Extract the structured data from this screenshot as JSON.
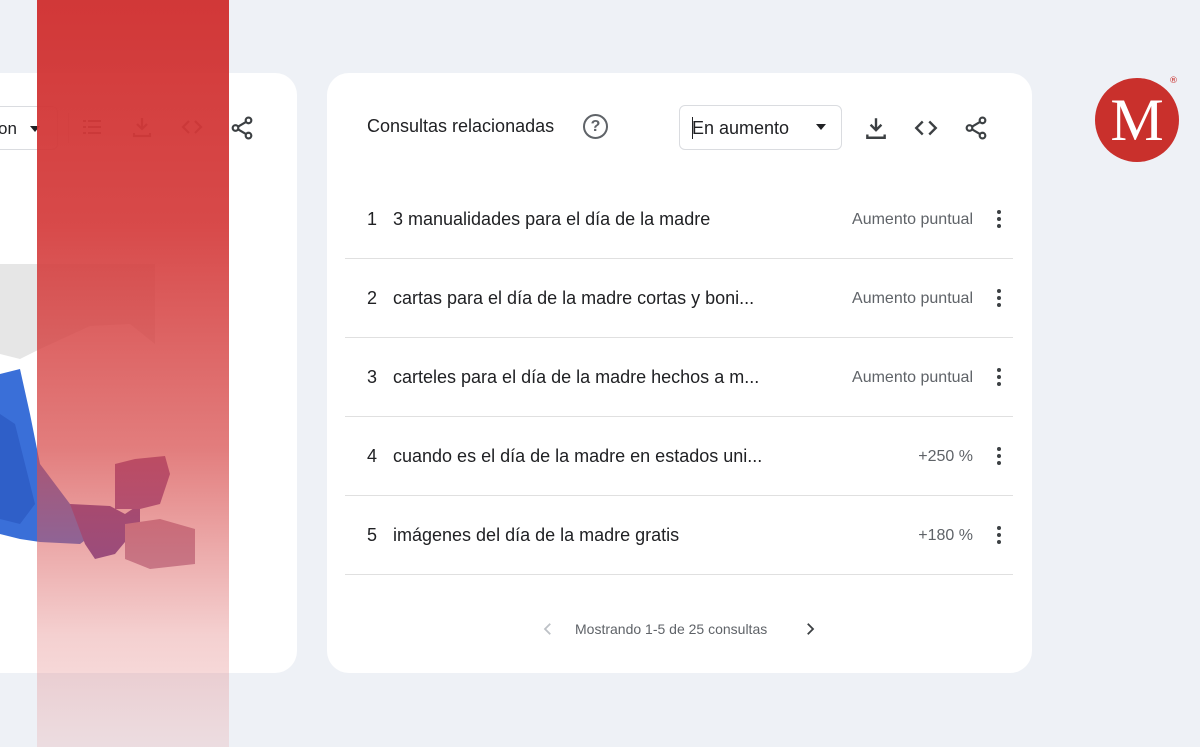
{
  "left_panel": {
    "select_value": "on",
    "icons": [
      "list-icon",
      "download-icon",
      "embed-icon",
      "share-icon"
    ]
  },
  "related_queries": {
    "title": "Consultas relacionadas",
    "help_icon": "help-icon",
    "filter": {
      "selected": "En aumento"
    },
    "toolbar": [
      "download-icon",
      "embed-icon",
      "share-icon"
    ],
    "rows": [
      {
        "rank": "1",
        "query": "3 manualidades para el día de la madre",
        "value": "Aumento puntual"
      },
      {
        "rank": "2",
        "query": "cartas para el día de la madre cortas y boni...",
        "value": "Aumento puntual"
      },
      {
        "rank": "3",
        "query": "carteles para el día de la madre hechos a m...",
        "value": "Aumento puntual"
      },
      {
        "rank": "4",
        "query": "cuando es el día de la madre en estados uni...",
        "value": "+250 %"
      },
      {
        "rank": "5",
        "query": "imágenes del día de la madre gratis",
        "value": "+180 %"
      }
    ],
    "pagination": {
      "text": "Mostrando 1-5 de 25 consultas"
    }
  },
  "logo": {
    "letter": "M",
    "mark": "®"
  },
  "colors": {
    "brand_red": "#c9302c",
    "banner_red": "#d03030",
    "map_blue": "#3a6fd8",
    "map_purple": "#6b3fa0"
  }
}
